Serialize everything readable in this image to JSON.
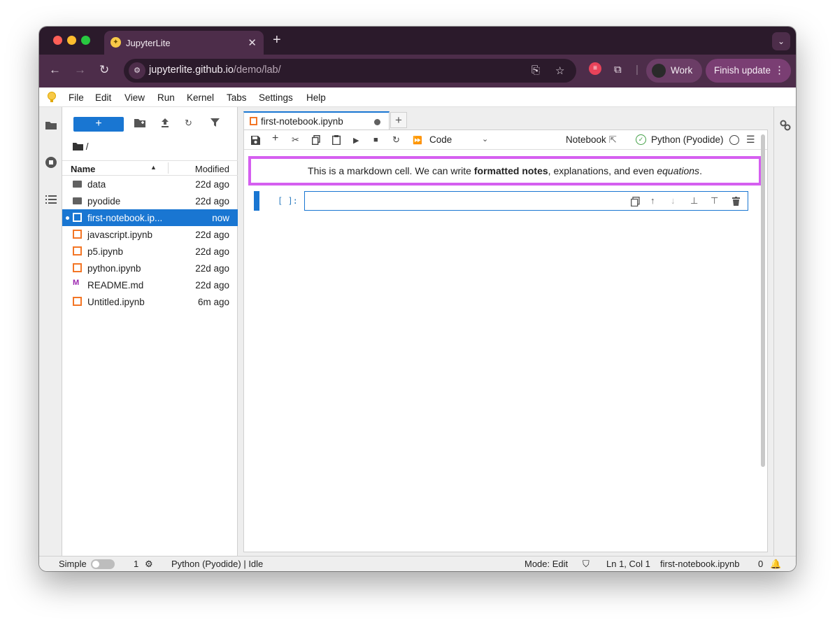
{
  "browser": {
    "tab_title": "JupyterLite",
    "url_host": "jupyterlite.github.io",
    "url_path": "/demo/lab/",
    "profile_label": "Work",
    "finish_update_label": "Finish update"
  },
  "menubar": {
    "items": [
      "File",
      "Edit",
      "View",
      "Run",
      "Kernel",
      "Tabs",
      "Settings",
      "Help"
    ]
  },
  "filebrowser": {
    "new_label": "+",
    "path": "/",
    "header_name": "Name",
    "header_modified": "Modified",
    "files": [
      {
        "name": "data",
        "modified": "22d ago",
        "type": "folder"
      },
      {
        "name": "pyodide",
        "modified": "22d ago",
        "type": "folder"
      },
      {
        "name": "first-notebook.ip...",
        "modified": "now",
        "type": "notebook",
        "selected": true
      },
      {
        "name": "javascript.ipynb",
        "modified": "22d ago",
        "type": "notebook"
      },
      {
        "name": "p5.ipynb",
        "modified": "22d ago",
        "type": "notebook"
      },
      {
        "name": "python.ipynb",
        "modified": "22d ago",
        "type": "notebook"
      },
      {
        "name": "README.md",
        "modified": "22d ago",
        "type": "markdown"
      },
      {
        "name": "Untitled.ipynb",
        "modified": "6m ago",
        "type": "notebook"
      }
    ]
  },
  "notebook": {
    "tab_title": "first-notebook.ipynb",
    "cell_type": "Code",
    "notebook_label": "Notebook",
    "kernel_name": "Python (Pyodide)",
    "markdown_cell": {
      "before": "This is a markdown cell. We can write ",
      "bold": "formatted notes",
      "middle": ", explanations, and even ",
      "italic": "equations",
      "after": "."
    },
    "code_prompt": "[ ]:"
  },
  "statusbar": {
    "mode_label": "Simple",
    "terminals_count": "1",
    "kernel_status": "Python (Pyodide) | Idle",
    "edit_mode": "Mode: Edit",
    "cursor": "Ln 1, Col 1",
    "filename": "first-notebook.ipynb",
    "notifications": "0"
  },
  "colors": {
    "accent": "#1976d2",
    "markdown_highlight": "#d55ff0",
    "browser_frame": "#4d2d4a"
  }
}
